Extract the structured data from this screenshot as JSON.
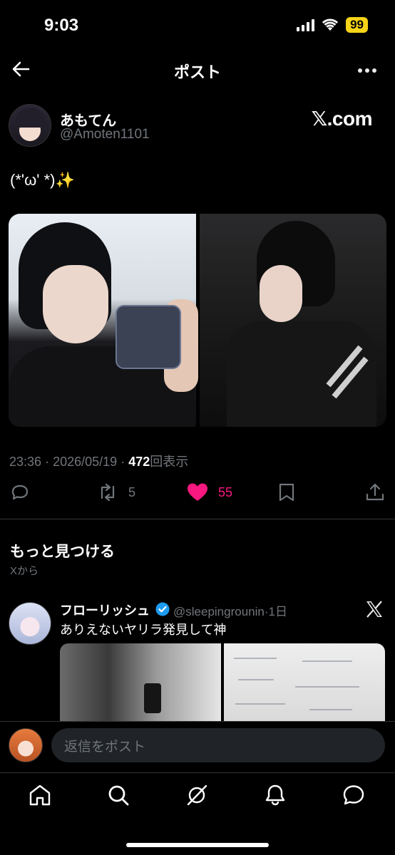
{
  "status": {
    "time": "9:03",
    "battery": "99"
  },
  "nav": {
    "title": "ポスト"
  },
  "author": {
    "name": "あもてん",
    "handle": "@Amoten1101"
  },
  "watermark": "𝕏.com",
  "tweet": {
    "text": "(*'ω' *)✨"
  },
  "meta": {
    "time": "23:36",
    "date": "2026/05/19",
    "views": "472",
    "views_label": "回表示",
    "sep": "·"
  },
  "actions": {
    "retweets": "5",
    "likes": "55"
  },
  "discover": {
    "title": "もっと見つける",
    "subtitle": "Xから"
  },
  "recommended": {
    "name": "フローリッシュ",
    "handle": "@sleepingrounin",
    "time": "·1日",
    "text": "ありえないヤリラ発見して神"
  },
  "reply": {
    "placeholder": "返信をポスト"
  },
  "colors": {
    "background": "#000000",
    "like": "#f91880",
    "verified": "#1d9bf0",
    "muted": "#71767b"
  },
  "icons": [
    "back-arrow-icon",
    "more-icon",
    "reply-icon",
    "retweet-icon",
    "heart-icon",
    "bookmark-icon",
    "share-icon",
    "verified-icon",
    "x-logo-icon",
    "home-icon",
    "search-icon",
    "grok-icon",
    "bell-icon",
    "messages-icon"
  ]
}
